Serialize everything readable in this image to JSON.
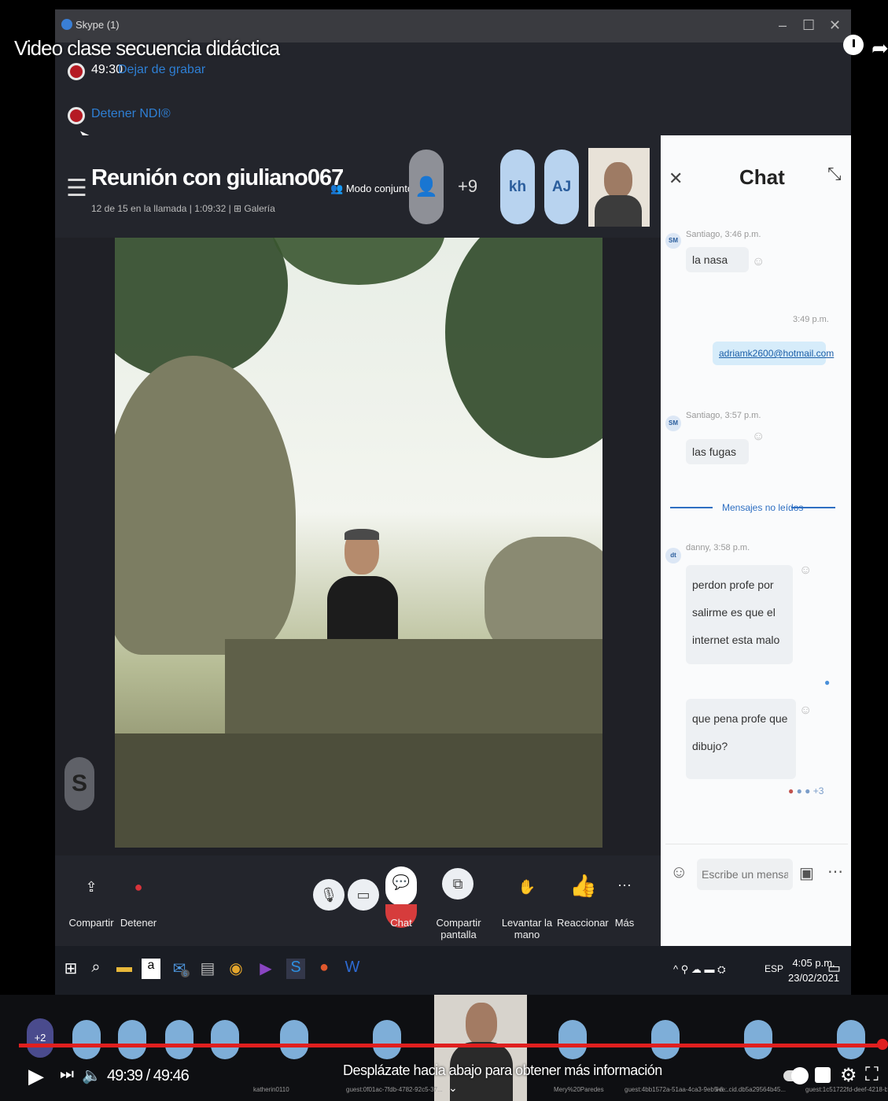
{
  "video": {
    "title": "Video clase secuencia didáctica",
    "clock_icon": "clock-icon",
    "share_icon": "share-arrow-icon"
  },
  "skype": {
    "window_title": "Skype (1)",
    "window_controls": [
      "–",
      "☐",
      "✕"
    ],
    "recording": {
      "time": "49:30",
      "stop_recording_link": "Dejar de grabar",
      "stop_ndi_link": "Detener NDI®"
    },
    "meeting": {
      "title": "Reunión con giuliano067",
      "subtitle": "12 de 15 en la llamada | 1:09:32 | ⊞ Galería",
      "mode_label": "Modo conjunto",
      "more_participants": "+9",
      "participants": [
        {
          "initials": "kh"
        },
        {
          "initials": "AJ"
        }
      ]
    },
    "controls": {
      "share": "Compartir",
      "stop": "Detener",
      "chat": "Chat",
      "share_screen": "Compartir pantalla",
      "raise_hand": "Levantar la mano",
      "react": "Reaccionar",
      "more": "Más"
    },
    "chat": {
      "title": "Chat",
      "messages": [
        {
          "initials": "SM",
          "meta": "Santiago, 3:46 p.m.",
          "text": "la nasa"
        },
        {
          "initials": "",
          "meta": "3:49 p.m.",
          "text": "adriamk2600@hotmail.com"
        },
        {
          "initials": "SM",
          "meta": "Santiago, 3:57 p.m.",
          "text": "las fugas"
        },
        {
          "initials": "dt",
          "meta": "danny, 3:58 p.m.",
          "text": "perdon profe por salirme es que el internet esta malo"
        },
        {
          "initials": "",
          "meta": "",
          "text": "que pena profe que dibujo?"
        }
      ],
      "unread_label": "Mensajes no leídos",
      "reactions_more": "+3",
      "composer_placeholder": "Escribe un mensaje"
    }
  },
  "taskbar": {
    "lang": "ESP",
    "time": "4:05 p.m.",
    "date": "23/02/2021",
    "mail_badge": "6"
  },
  "participants_strip": {
    "more": "+2",
    "names": [
      "katherin0110",
      "guest:0f01ac-7fdb-4782-92c5-37...",
      "Mery%20Paredes",
      "guest:4bb1572a-51aa-4ca3-9eb5-6...",
      "live:.cid.db5a29564b45...",
      "guest:1c51722fd-deef-4218-b2..."
    ]
  },
  "player": {
    "current_time": "49:39",
    "separator": "/",
    "duration": "49:46",
    "time_display": "49:39 / 49:46",
    "scroll_hint": "Desplázate hacia abajo para obtener más información",
    "progress_fraction": 0.9976
  }
}
